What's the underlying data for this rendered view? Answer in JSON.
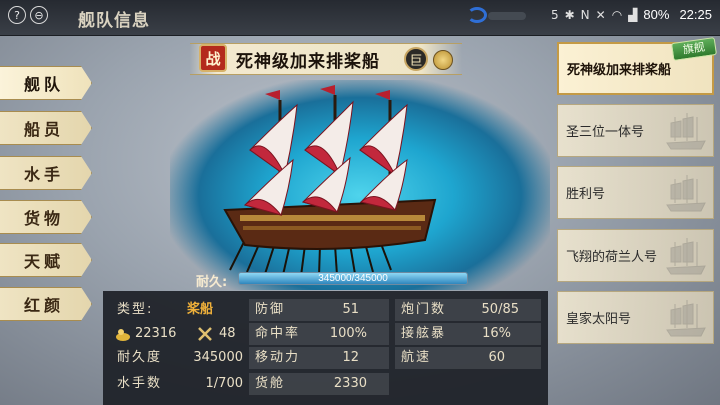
{
  "header": {
    "title": "舰队信息",
    "help_icon": "help-icon",
    "back_icon": "back-icon"
  },
  "status_bar": {
    "signal_number": "5",
    "battery": "80%",
    "time": "22:25"
  },
  "ship": {
    "battle_badge": "战",
    "name": "死神级加来排桨船",
    "size_badge": "巨",
    "durability_label": "耐久:",
    "durability_text": "345000/345000",
    "durability_fraction": 1.0
  },
  "menu": {
    "items": [
      {
        "label": "舰队",
        "active": true
      },
      {
        "label": "船员",
        "active": false
      },
      {
        "label": "水手",
        "active": false
      },
      {
        "label": "货物",
        "active": false
      },
      {
        "label": "天赋",
        "active": false
      },
      {
        "label": "红颜",
        "active": false
      }
    ]
  },
  "fleet": {
    "flagship_tag": "旗舰",
    "ships": [
      {
        "name": "死神级加来排桨船",
        "active": true
      },
      {
        "name": "圣三位一体号",
        "active": false
      },
      {
        "name": "胜利号",
        "active": false
      },
      {
        "name": "飞翔的荷兰人号",
        "active": false
      },
      {
        "name": "皇家太阳号",
        "active": false
      }
    ]
  },
  "stats": {
    "type_label": "类型:",
    "type_value": "桨船",
    "gold_value": "22316",
    "swords_value": "48",
    "durability_label": "耐久度",
    "durability_value": "345000",
    "sailors_label": "水手数",
    "sailors_value": "1/700",
    "defense_label": "防御",
    "defense_value": "51",
    "hit_label": "命中率",
    "hit_value": "100%",
    "move_label": "移动力",
    "move_value": "12",
    "cargo_label": "货舱",
    "cargo_value": "2330",
    "cannon_label": "炮门数",
    "cannon_value": "50/85",
    "board_label": "接舷暴",
    "board_value": "16%",
    "speed_label": "航速",
    "speed_value": "60"
  }
}
